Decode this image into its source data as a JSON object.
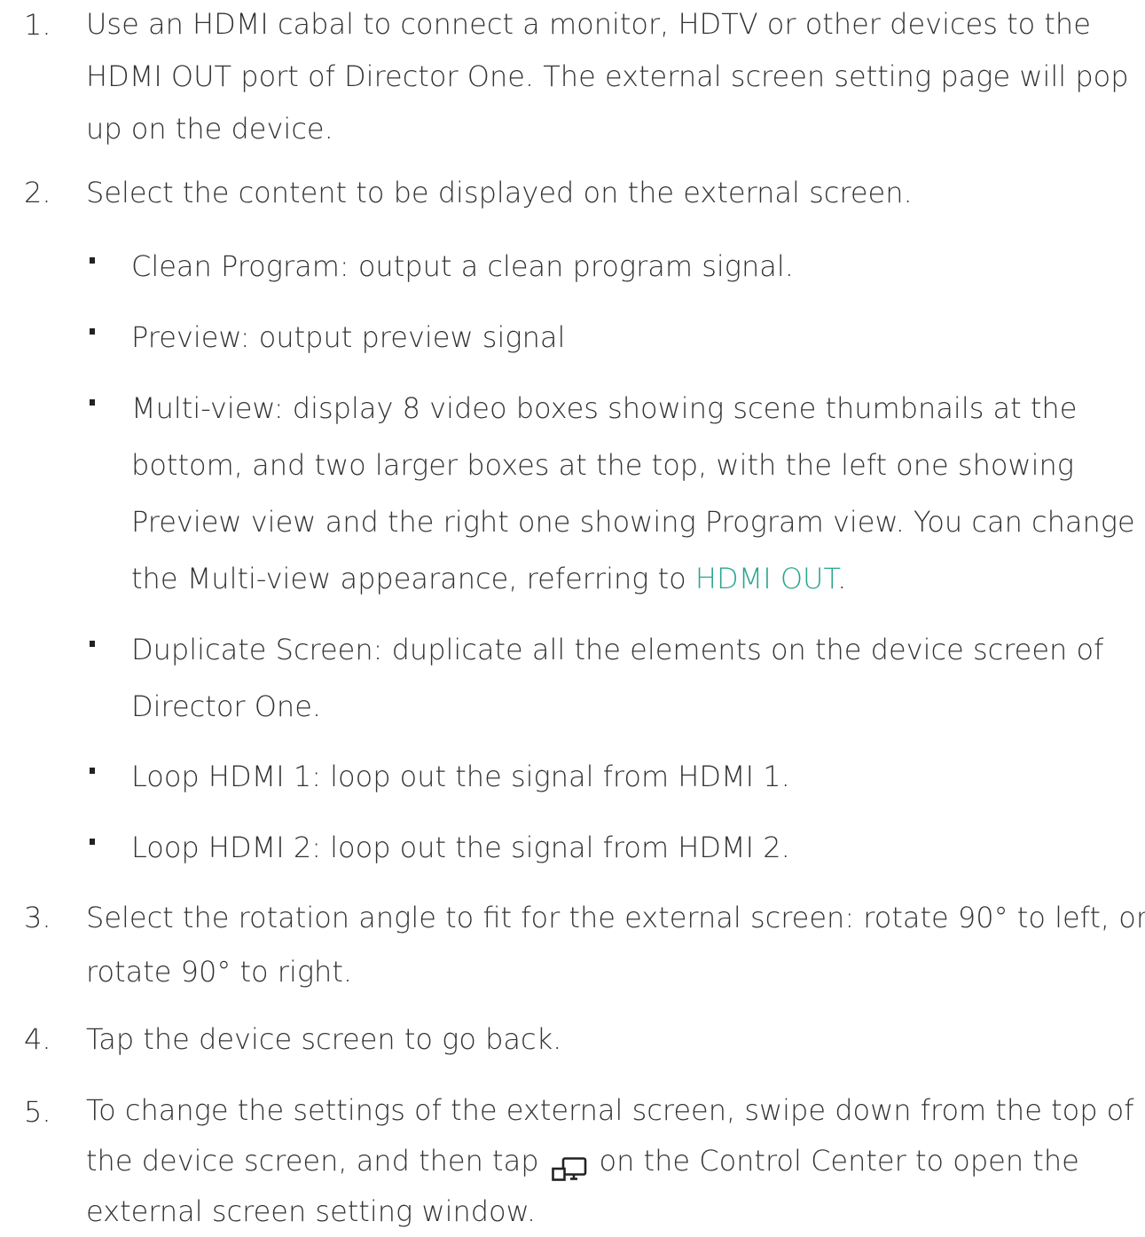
{
  "steps": [
    {
      "number": "1.",
      "lines": [
        "Use an HDMI cabal to connect a monitor, HDTV or other devices to the",
        "HDMI OUT port of Director One. The external screen setting page will pop",
        "up on the device."
      ]
    },
    {
      "number": "2.",
      "lines": [
        "Select the content to be displayed on the external screen."
      ]
    },
    {
      "number": "3.",
      "lines": [
        "Select the rotation angle to fit for the external screen: rotate 90° to left, or",
        "rotate 90° to right."
      ]
    },
    {
      "number": "4.",
      "lines": [
        "Tap the device screen to go back."
      ]
    },
    {
      "number": "5.",
      "line1": "To change the settings of the external screen, swipe down from the top of",
      "line2_before": "the device screen, and then tap",
      "line2_after": "on the Control Center to open the",
      "line3": "external screen setting window.",
      "icon": "external-screen-icon"
    }
  ],
  "bullets": [
    {
      "lines": [
        "Clean Program: output a clean program signal."
      ]
    },
    {
      "lines": [
        "Preview: output preview signal"
      ]
    },
    {
      "line1": "Multi-view: display 8 video boxes showing scene thumbnails at the",
      "line2": "bottom, and two larger boxes at the top, with the left one showing",
      "line3": "Preview view and the right one showing Program view. You can change",
      "line4_before": "the Multi-view appearance, referring to ",
      "line4_link": "HDMI OUT",
      "line4_after": "."
    },
    {
      "lines": [
        "Duplicate Screen: duplicate all the elements on the device screen of",
        "Director One."
      ]
    },
    {
      "lines": [
        "Loop HDMI 1: loop out the signal from HDMI 1."
      ]
    },
    {
      "lines": [
        "Loop HDMI 2: loop out the signal from HDMI 2."
      ]
    }
  ],
  "colors": {
    "text": "#333333",
    "link": "#2aa58c",
    "bullet": "#222222"
  }
}
